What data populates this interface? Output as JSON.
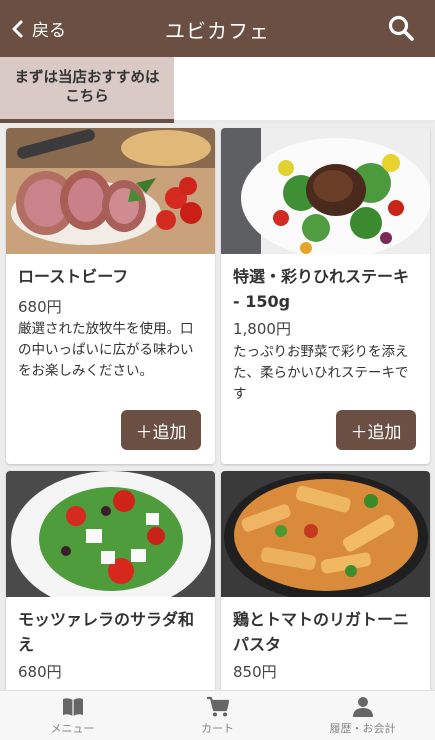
{
  "header": {
    "back_label": "戻る",
    "title": "ユビカフェ"
  },
  "tabs": [
    {
      "label": "まずは当店おすすめはこちら"
    }
  ],
  "menu": [
    {
      "name": "ローストビーフ",
      "price": "680円",
      "desc": "厳選された放牧牛を使用。口の中いっぱいに広がる味わいをお楽しみください。",
      "add_label": "＋追加"
    },
    {
      "name": "特選・彩りひれステーキ - 150g",
      "price": "1,800円",
      "desc": "たっぷりお野菜で彩りを添えた、柔らかいひれステーキです",
      "add_label": "＋追加"
    },
    {
      "name": "モッツァレラのサラダ和え",
      "price": "680円"
    },
    {
      "name": "鶏とトマトのリガトーニパスタ",
      "price": "850円"
    }
  ],
  "bottom_nav": [
    {
      "label": "メニュー",
      "icon": "book-icon"
    },
    {
      "label": "カート",
      "icon": "cart-icon"
    },
    {
      "label": "履歴・お会計",
      "icon": "person-icon"
    }
  ],
  "colors": {
    "brand": "#6b4f43",
    "tab_active_bg": "#d9cac5",
    "background": "#ececec"
  }
}
